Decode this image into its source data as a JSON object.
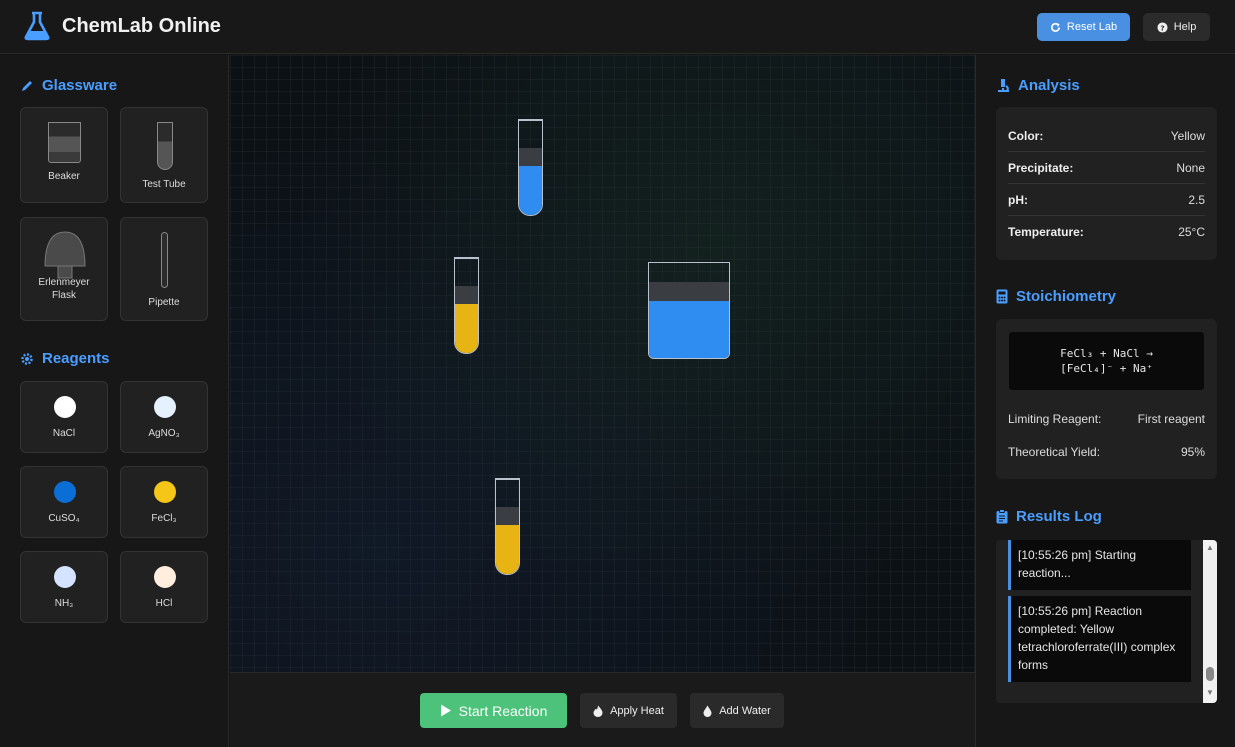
{
  "header": {
    "title": "ChemLab Online",
    "reset_label": "Reset Lab",
    "help_label": "Help"
  },
  "glassware": {
    "title": "Glassware",
    "items": [
      {
        "label": "Beaker",
        "icon": "beaker-icon"
      },
      {
        "label": "Test Tube",
        "icon": "test-tube-icon"
      },
      {
        "label": "Erlenmeyer\nFlask",
        "icon": "erlenmeyer-flask-icon"
      },
      {
        "label": "Pipette",
        "icon": "pipette-icon"
      }
    ]
  },
  "reagents": {
    "title": "Reagents",
    "items": [
      {
        "label": "NaCl",
        "color": "#ffffff"
      },
      {
        "label": "AgNO₃",
        "color": "#e6f1ff"
      },
      {
        "label": "CuSO₄",
        "color": "#0b6dd6"
      },
      {
        "label": "FeCl₃",
        "color": "#f5c518"
      },
      {
        "label": "NH₃",
        "color": "#d4e3ff"
      },
      {
        "label": "HCl",
        "color": "#ffeedd"
      }
    ]
  },
  "workspace": {
    "vessels": [
      {
        "type": "test-tube",
        "liquid_color": "#2f8cf0",
        "fill": 0.5
      },
      {
        "type": "test-tube",
        "liquid_color": "#e8b414",
        "fill": 0.5
      },
      {
        "type": "beaker",
        "liquid_color": "#2f8cf0",
        "fill": 0.6
      },
      {
        "type": "test-tube",
        "liquid_color": "#e8b414",
        "fill": 0.5
      }
    ]
  },
  "controls": {
    "start_label": "Start Reaction",
    "heat_label": "Apply Heat",
    "water_label": "Add Water"
  },
  "analysis": {
    "title": "Analysis",
    "rows": [
      {
        "key": "Color:",
        "value": "Yellow"
      },
      {
        "key": "Precipitate:",
        "value": "None"
      },
      {
        "key": "pH:",
        "value": "2.5"
      },
      {
        "key": "Temperature:",
        "value": "25°C"
      }
    ]
  },
  "stoichiometry": {
    "title": "Stoichiometry",
    "equation_line1": "FeCl₃ + NaCl →",
    "equation_line2": "[FeCl₄]⁻ + Na⁺",
    "limiting_key": "Limiting Reagent:",
    "limiting_value": "First reagent",
    "yield_key": "Theoretical Yield:",
    "yield_value": "95%"
  },
  "results_log": {
    "title": "Results Log",
    "entries": [
      "[10:55:26 pm] Starting reaction...",
      "[10:55:26 pm] Reaction completed: Yellow tetrachloroferrate(III) complex forms"
    ]
  },
  "colors": {
    "accent": "#4a9eff",
    "primary_button": "#4a90e2",
    "start_button": "#4cc27a"
  }
}
